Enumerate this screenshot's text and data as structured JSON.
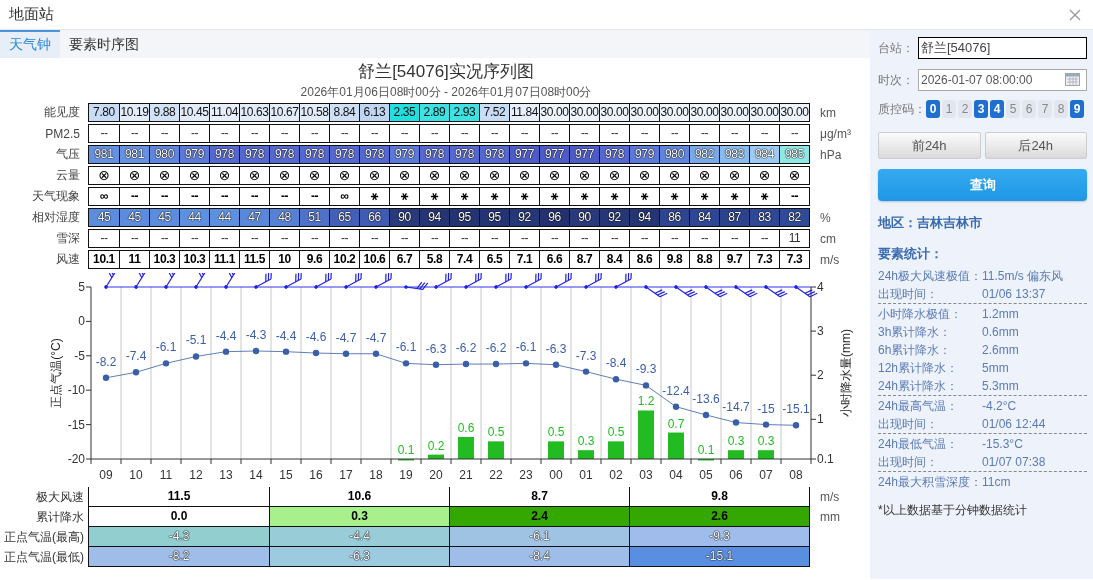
{
  "window": {
    "title": "地面站"
  },
  "tabs": [
    {
      "label": "天气钟",
      "selected": true
    },
    {
      "label": "要素时序图",
      "selected": false
    }
  ],
  "report": {
    "title": "舒兰[54076]实况序列图",
    "time_range": "2026年01月06日08时00分 - 2026年01月07日08时00分"
  },
  "observations": [
    {
      "label": "能见度",
      "kind": "shaded",
      "unit": "km",
      "cells": [
        {
          "text": "7.80",
          "color": "#c9dcf5"
        },
        {
          "text": "10.19",
          "color": "#e3edfa"
        },
        {
          "text": "9.88",
          "color": "#d3e2f7"
        },
        {
          "text": "10.45",
          "color": "#e3edfa"
        },
        {
          "text": "11.04",
          "color": "#e6effb"
        },
        {
          "text": "10.63",
          "color": "#e3edfa"
        },
        {
          "text": "10.67",
          "color": "#e3edfa"
        },
        {
          "text": "10.58",
          "color": "#e3edfa"
        },
        {
          "text": "8.84",
          "color": "#cfdff6"
        },
        {
          "text": "6.13",
          "color": "#c0d5f2"
        },
        {
          "text": "2.35",
          "color": "#22dede"
        },
        {
          "text": "2.89",
          "color": "#3ee2e2"
        },
        {
          "text": "2.93",
          "color": "#3ee2e2"
        },
        {
          "text": "7.52",
          "color": "#c9dcf5"
        },
        {
          "text": "11.84",
          "color": "#e6effb"
        },
        {
          "text": "30.00",
          "color": "#eef4fc"
        },
        {
          "text": "30.00",
          "color": "#eef4fc"
        },
        {
          "text": "30.00",
          "color": "#eef4fc"
        },
        {
          "text": "30.00",
          "color": "#eef4fc"
        },
        {
          "text": "30.00",
          "color": "#eef4fc"
        },
        {
          "text": "30.00",
          "color": "#eef4fc"
        },
        {
          "text": "30.00",
          "color": "#eef4fc"
        },
        {
          "text": "30.00",
          "color": "#eef4fc"
        },
        {
          "text": "30.00",
          "color": "#eef4fc"
        }
      ]
    },
    {
      "label": "PM2.5",
      "kind": "plain",
      "unit": "μg/m³",
      "cells": [
        {
          "text": "--"
        },
        {
          "text": "--"
        },
        {
          "text": "--"
        },
        {
          "text": "--"
        },
        {
          "text": "--"
        },
        {
          "text": "--"
        },
        {
          "text": "--"
        },
        {
          "text": "--"
        },
        {
          "text": "--"
        },
        {
          "text": "--"
        },
        {
          "text": "--"
        },
        {
          "text": "--"
        },
        {
          "text": "--"
        },
        {
          "text": "--"
        },
        {
          "text": "--"
        },
        {
          "text": "--"
        },
        {
          "text": "--"
        },
        {
          "text": "--"
        },
        {
          "text": "--"
        },
        {
          "text": "--"
        },
        {
          "text": "--"
        },
        {
          "text": "--"
        },
        {
          "text": "--"
        },
        {
          "text": "--"
        }
      ]
    },
    {
      "label": "气压",
      "kind": "outlined",
      "unit": "hPa",
      "cells": [
        {
          "text": "981",
          "color": "#6591e0"
        },
        {
          "text": "981",
          "color": "#6591e0"
        },
        {
          "text": "980",
          "color": "#5f86de"
        },
        {
          "text": "979",
          "color": "#5b79d8"
        },
        {
          "text": "978",
          "color": "#5468cf"
        },
        {
          "text": "978",
          "color": "#5468cf"
        },
        {
          "text": "978",
          "color": "#5468cf"
        },
        {
          "text": "978",
          "color": "#5468cf"
        },
        {
          "text": "978",
          "color": "#5468cf"
        },
        {
          "text": "978",
          "color": "#5468cf"
        },
        {
          "text": "979",
          "color": "#5b79d8"
        },
        {
          "text": "978",
          "color": "#5468cf"
        },
        {
          "text": "978",
          "color": "#5468cf"
        },
        {
          "text": "978",
          "color": "#5468cf"
        },
        {
          "text": "977",
          "color": "#4c5bc6"
        },
        {
          "text": "977",
          "color": "#4c5bc6"
        },
        {
          "text": "977",
          "color": "#4c5bc6"
        },
        {
          "text": "978",
          "color": "#5468cf"
        },
        {
          "text": "979",
          "color": "#5b79d8"
        },
        {
          "text": "980",
          "color": "#5f86de"
        },
        {
          "text": "982",
          "color": "#78a9e8"
        },
        {
          "text": "983",
          "color": "#88bbee"
        },
        {
          "text": "984",
          "color": "#9ccaf2"
        },
        {
          "text": "985",
          "color": "#8ee8e6"
        }
      ]
    },
    {
      "label": "云量",
      "kind": "symbol",
      "cells": [
        {
          "text": "⊗"
        },
        {
          "text": "⊗"
        },
        {
          "text": "⊗"
        },
        {
          "text": "⊗"
        },
        {
          "text": "⊗"
        },
        {
          "text": "⊗"
        },
        {
          "text": "⊗"
        },
        {
          "text": "⊗"
        },
        {
          "text": "⊗"
        },
        {
          "text": "⊗"
        },
        {
          "text": "⊗"
        },
        {
          "text": "⊗"
        },
        {
          "text": "⊗"
        },
        {
          "text": "⊗"
        },
        {
          "text": "⊗"
        },
        {
          "text": "⊗"
        },
        {
          "text": "⊗"
        },
        {
          "text": "⊗"
        },
        {
          "text": "⊗"
        },
        {
          "text": "⊗"
        },
        {
          "text": "⊗"
        },
        {
          "text": "⊗"
        },
        {
          "text": "⊗"
        },
        {
          "text": "⊗"
        }
      ]
    },
    {
      "label": "天气现象",
      "kind": "bold",
      "cells": [
        {
          "text": "∞"
        },
        {
          "text": "--"
        },
        {
          "text": "--"
        },
        {
          "text": "--"
        },
        {
          "text": "--"
        },
        {
          "text": "--"
        },
        {
          "text": "--"
        },
        {
          "text": "--"
        },
        {
          "text": "∞"
        },
        {
          "text": "⚹"
        },
        {
          "text": "⚹"
        },
        {
          "text": "⚹"
        },
        {
          "text": "⚹"
        },
        {
          "text": "⚹"
        },
        {
          "text": "⚹"
        },
        {
          "text": "⚹"
        },
        {
          "text": "⚹"
        },
        {
          "text": "⚹"
        },
        {
          "text": "⚹"
        },
        {
          "text": "⚹"
        },
        {
          "text": "⚹"
        },
        {
          "text": "⚹"
        },
        {
          "text": "⚹"
        },
        {
          "text": "--"
        }
      ]
    },
    {
      "label": "相对湿度",
      "kind": "outlined",
      "unit": "%",
      "cells": [
        {
          "text": "45",
          "color": "#5c8cde"
        },
        {
          "text": "45",
          "color": "#5c8cde"
        },
        {
          "text": "45",
          "color": "#5c8cde"
        },
        {
          "text": "44",
          "color": "#5e90e0"
        },
        {
          "text": "44",
          "color": "#5e90e0"
        },
        {
          "text": "47",
          "color": "#5987d9"
        },
        {
          "text": "48",
          "color": "#5682d6"
        },
        {
          "text": "51",
          "color": "#4e72c8"
        },
        {
          "text": "65",
          "color": "#4260b8"
        },
        {
          "text": "66",
          "color": "#3f5bb2"
        },
        {
          "text": "90",
          "color": "#283a7a"
        },
        {
          "text": "94",
          "color": "#253574"
        },
        {
          "text": "95",
          "color": "#243372"
        },
        {
          "text": "95",
          "color": "#243372"
        },
        {
          "text": "92",
          "color": "#263777"
        },
        {
          "text": "96",
          "color": "#233170"
        },
        {
          "text": "90",
          "color": "#283a7a"
        },
        {
          "text": "92",
          "color": "#263777"
        },
        {
          "text": "94",
          "color": "#253574"
        },
        {
          "text": "86",
          "color": "#2d4490"
        },
        {
          "text": "84",
          "color": "#2e4693"
        },
        {
          "text": "87",
          "color": "#2c428d"
        },
        {
          "text": "83",
          "color": "#2f4896"
        },
        {
          "text": "82",
          "color": "#2f4a98"
        }
      ]
    },
    {
      "label": "雪深",
      "kind": "plain",
      "unit": "cm",
      "cells": [
        {
          "text": "--"
        },
        {
          "text": "--"
        },
        {
          "text": "--"
        },
        {
          "text": "--"
        },
        {
          "text": "--"
        },
        {
          "text": "--"
        },
        {
          "text": "--"
        },
        {
          "text": "--"
        },
        {
          "text": "--"
        },
        {
          "text": "--"
        },
        {
          "text": "--"
        },
        {
          "text": "--"
        },
        {
          "text": "--"
        },
        {
          "text": "--"
        },
        {
          "text": "--"
        },
        {
          "text": "--"
        },
        {
          "text": "--"
        },
        {
          "text": "--"
        },
        {
          "text": "--"
        },
        {
          "text": "--"
        },
        {
          "text": "--"
        },
        {
          "text": "--"
        },
        {
          "text": "--"
        },
        {
          "text": "11"
        }
      ]
    },
    {
      "label": "风速",
      "kind": "bold",
      "unit": "m/s",
      "cells": [
        {
          "text": "10.1"
        },
        {
          "text": "11"
        },
        {
          "text": "10.3"
        },
        {
          "text": "10.3"
        },
        {
          "text": "11.1"
        },
        {
          "text": "11.5"
        },
        {
          "text": "10"
        },
        {
          "text": "9.6"
        },
        {
          "text": "10.2"
        },
        {
          "text": "10.6"
        },
        {
          "text": "6.7"
        },
        {
          "text": "5.8"
        },
        {
          "text": "7.4"
        },
        {
          "text": "6.5"
        },
        {
          "text": "7.1"
        },
        {
          "text": "6.6"
        },
        {
          "text": "8.7"
        },
        {
          "text": "8.4"
        },
        {
          "text": "8.6"
        },
        {
          "text": "9.8"
        },
        {
          "text": "8.8"
        },
        {
          "text": "9.7"
        },
        {
          "text": "7.3"
        },
        {
          "text": "7.3"
        }
      ]
    }
  ],
  "chart": {
    "wind_barbs": [
      {
        "kind": "steep"
      },
      {
        "kind": "steep"
      },
      {
        "kind": "steep"
      },
      {
        "kind": "steep"
      },
      {
        "kind": "steep"
      },
      {
        "kind": "rising"
      },
      {
        "kind": "rising"
      },
      {
        "kind": "rising"
      },
      {
        "kind": "rising"
      },
      {
        "kind": "rising"
      },
      {
        "kind": "flat"
      },
      {
        "kind": "rising"
      },
      {
        "kind": "rising"
      },
      {
        "kind": "rising"
      },
      {
        "kind": "rising"
      },
      {
        "kind": "rising"
      },
      {
        "kind": "rising"
      },
      {
        "kind": "rising"
      },
      {
        "kind": "falling"
      },
      {
        "kind": "falling"
      },
      {
        "kind": "falling"
      },
      {
        "kind": "falling"
      },
      {
        "kind": "falling"
      },
      {
        "kind": "falling"
      }
    ],
    "temperature": {
      "chart_data": {
        "type": "line",
        "ylabel": "正点气温(°C)",
        "categories": [
          "09",
          "10",
          "11",
          "12",
          "13",
          "14",
          "15",
          "16",
          "17",
          "18",
          "19",
          "20",
          "21",
          "22",
          "23",
          "00",
          "01",
          "02",
          "03",
          "04",
          "05",
          "06",
          "07",
          "08"
        ],
        "ylim": [
          -20,
          5
        ],
        "yticks": [
          5,
          0,
          -5,
          -10,
          -15,
          -20
        ],
        "data_labels": true,
        "series": [
          {
            "color": "#3b5ea8",
            "marker": "circle",
            "values": [
              -8.2,
              -7.4,
              -6.1,
              -5.1,
              -4.4,
              -4.3,
              -4.4,
              -4.6,
              -4.7,
              -4.7,
              -6.1,
              -6.3,
              -6.2,
              -6.2,
              -6.1,
              -6.3,
              -7.3,
              -8.4,
              -9.3,
              -12.4,
              -13.6,
              -14.7,
              -15,
              -15.1
            ]
          }
        ]
      }
    },
    "precipitation": {
      "chart_data": {
        "type": "bar",
        "ylabel": "小时降水量(mm)",
        "ylim": [
          0.1,
          4
        ],
        "yticks": [
          4,
          3,
          2,
          1,
          0.1
        ],
        "data_labels": true,
        "series": [
          {
            "color": "#22bb22",
            "values": [
              null,
              null,
              null,
              null,
              null,
              null,
              null,
              null,
              null,
              null,
              0.1,
              0.2,
              0.6,
              0.5,
              null,
              0.5,
              0.3,
              0.5,
              1.2,
              0.7,
              0.1,
              0.3,
              0.3,
              null
            ]
          }
        ]
      }
    }
  },
  "summary": [
    {
      "label": "极大风速",
      "kind": "bold",
      "unit": "m/s",
      "cells": [
        {
          "text": "11.5"
        },
        {
          "text": "10.6"
        },
        {
          "text": "8.7"
        },
        {
          "text": "9.8"
        }
      ]
    },
    {
      "label": "累计降水",
      "kind": "bold",
      "unit": "mm",
      "cells": [
        {
          "text": "0.0",
          "color": "#ffffff"
        },
        {
          "text": "0.3",
          "color": "#a8f08c"
        },
        {
          "text": "2.4",
          "color": "#34a800"
        },
        {
          "text": "2.6",
          "color": "#34a800"
        }
      ]
    },
    {
      "label": "正点气温(最高)",
      "kind": "outlined",
      "cells": [
        {
          "text": "-4.3",
          "color": "#92cdd0"
        },
        {
          "text": "-4.4",
          "color": "#98ccd6"
        },
        {
          "text": "-6.1",
          "color": "#9fc3e3"
        },
        {
          "text": "-9.3",
          "color": "#a0bcea"
        }
      ]
    },
    {
      "label": "正点气温(最低)",
      "kind": "outlined",
      "cells": [
        {
          "text": "-8.2",
          "color": "#9ebde9"
        },
        {
          "text": "-6.3",
          "color": "#9ccbe0"
        },
        {
          "text": "-8.4",
          "color": "#9ebde9"
        },
        {
          "text": "-15.1",
          "color": "#5a8ee0"
        }
      ]
    }
  ],
  "side_panel": {
    "station": {
      "label": "台站：",
      "value": "舒兰[54076]"
    },
    "time": {
      "label": "时次：",
      "value": "2026-01-07 08:00:00"
    },
    "quality_label": "质控码：",
    "quality_codes": [
      {
        "label": "0",
        "selected": true
      },
      {
        "label": "1",
        "selected": false
      },
      {
        "label": "2",
        "selected": false
      },
      {
        "label": "3",
        "selected": true
      },
      {
        "label": "4",
        "selected": true
      },
      {
        "label": "5",
        "selected": false
      },
      {
        "label": "6",
        "selected": false
      },
      {
        "label": "7",
        "selected": false
      },
      {
        "label": "8",
        "selected": false
      },
      {
        "label": "9",
        "selected": true
      }
    ],
    "buttons": [
      "前24h",
      "后24h"
    ],
    "query_button": "查询",
    "region": "地区：吉林吉林市",
    "stats_title": "要素统计：",
    "stat_groups": [
      {
        "items": [
          {
            "label": "24h极大风速极值：",
            "value": "11.5m/s 偏东风"
          },
          {
            "label": "出现时间：",
            "value": "01/06 13:37"
          }
        ]
      },
      {
        "items": [
          {
            "label": "小时降水极值：",
            "value": "1.2mm"
          },
          {
            "label": "3h累计降水：",
            "value": "0.6mm"
          },
          {
            "label": "6h累计降水：",
            "value": "2.6mm"
          },
          {
            "label": "12h累计降水：",
            "value": "5mm"
          },
          {
            "label": "24h累计降水：",
            "value": "5.3mm"
          }
        ]
      },
      {
        "items": [
          {
            "label": "24h最高气温：",
            "value": "-4.2°C"
          },
          {
            "label": "出现时间：",
            "value": "01/06 12:44"
          }
        ]
      },
      {
        "items": [
          {
            "label": "24h最低气温：",
            "value": "-15.3°C"
          },
          {
            "label": "出现时间：",
            "value": "01/07 07:38"
          }
        ]
      },
      {
        "items": [
          {
            "label": "24h最大积雪深度：",
            "value": "11cm"
          }
        ]
      }
    ],
    "footnote": "*以上数据基于分钟数据统计"
  }
}
